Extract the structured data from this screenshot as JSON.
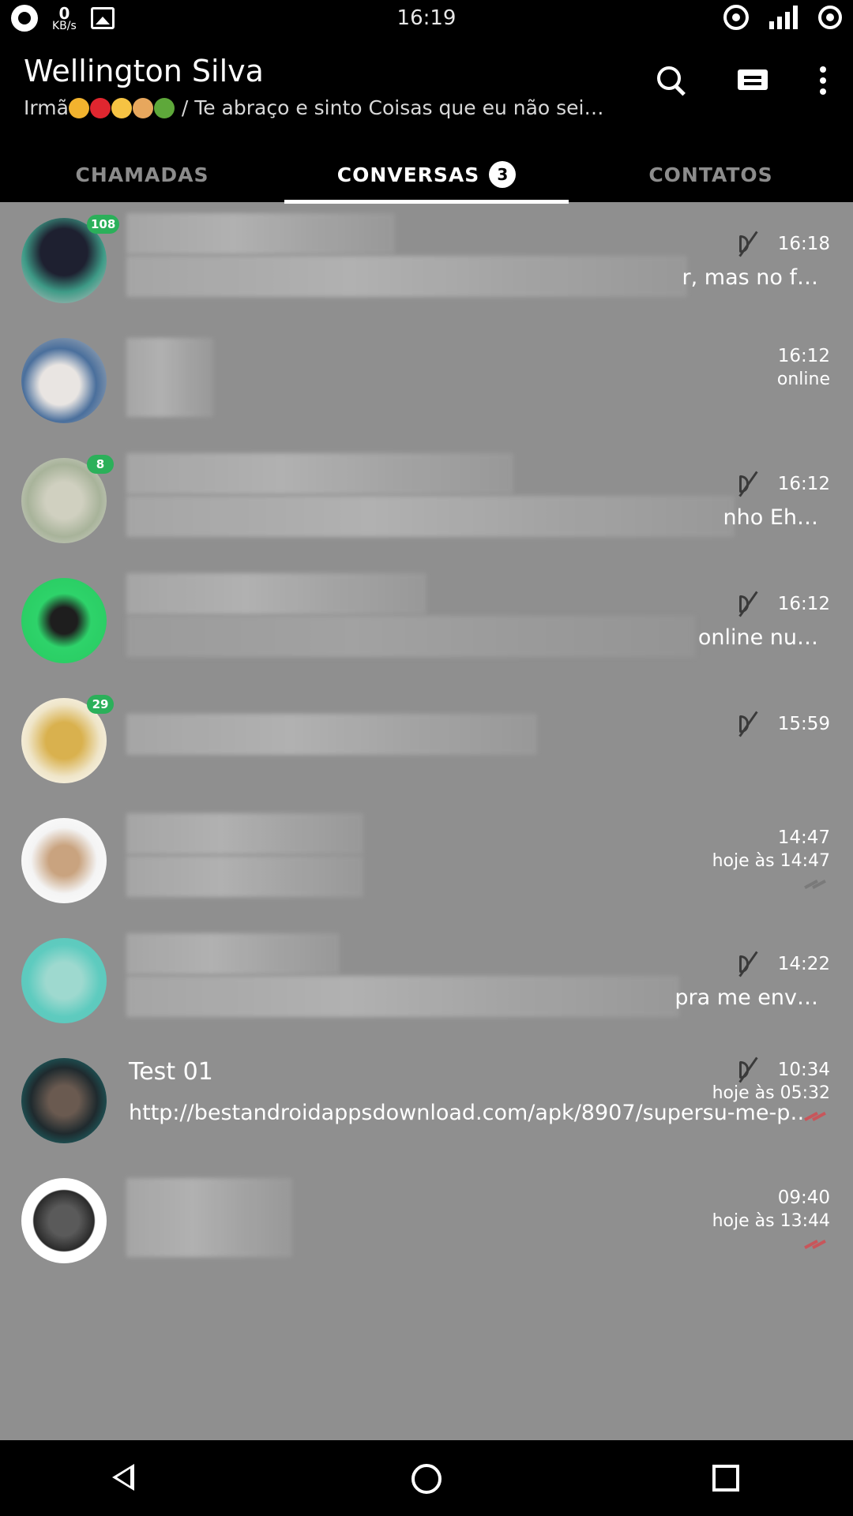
{
  "status_bar": {
    "time": "16:19",
    "net_speed_value": "0",
    "net_speed_unit": "KB/s",
    "icons": [
      "whatsapp-icon",
      "net-speed-icon",
      "image-icon",
      "hotspot-icon",
      "signal-icon",
      "battery-icon"
    ]
  },
  "header": {
    "title": "Wellington Silva",
    "subtitle_prefix": "Irmã",
    "subtitle_text": " / Te abraço e sinto Coisas que eu não sei…",
    "actions": [
      "search-icon",
      "new-chat-icon",
      "more-options-icon"
    ]
  },
  "tabs": [
    {
      "label": "CHAMADAS",
      "badge": "",
      "active": false
    },
    {
      "label": "CONVERSAS",
      "badge": "3",
      "active": true
    },
    {
      "label": "CONTATOS",
      "badge": "",
      "active": false
    }
  ],
  "chats": [
    {
      "name": "",
      "message_tail": "r, mas no f…",
      "time": "16:18",
      "sub": "",
      "unread": "108",
      "muted": true
    },
    {
      "name": "",
      "message_tail": "",
      "time": "16:12",
      "sub": "online",
      "unread": "",
      "muted": false
    },
    {
      "name": "",
      "message_tail": "nho Eh…",
      "time": "16:12",
      "sub": "",
      "unread": "8",
      "muted": true
    },
    {
      "name": "",
      "message_tail": "online nu…",
      "time": "16:12",
      "sub": "",
      "unread": "",
      "muted": true
    },
    {
      "name": "",
      "message_tail": "",
      "time": "15:59",
      "sub": "",
      "unread": "29",
      "muted": true
    },
    {
      "name": "",
      "message_tail": "",
      "time": "14:47",
      "sub": "hoje às 14:47",
      "unread": "",
      "muted": false
    },
    {
      "name": "",
      "message_tail": "pra me env…",
      "time": "14:22",
      "sub": "",
      "unread": "",
      "muted": true
    },
    {
      "name": "Test 01",
      "message": "http://bestandroidappsdownload.com/apk/8907/supersu-me-p…",
      "time": "10:34",
      "sub": "hoje às 05:32",
      "unread": "",
      "muted": true
    },
    {
      "name": "",
      "message_tail": "",
      "time": "09:40",
      "sub": "hoje às 13:44",
      "unread": "",
      "muted": false
    }
  ],
  "colors": {
    "background": "#8f8f8f",
    "bars": "#000000",
    "unread_badge": "#2bb05a",
    "read_check": "#c8565b"
  },
  "nav_bar": [
    "back-icon",
    "home-icon",
    "recents-icon"
  ]
}
